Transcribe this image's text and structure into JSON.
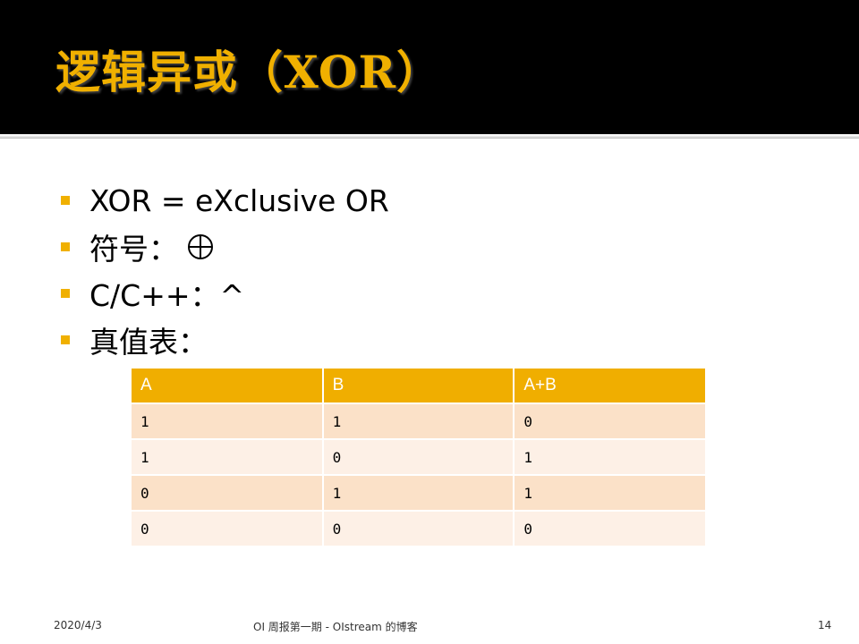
{
  "slide": {
    "title": "逻辑异或（XOR）",
    "bullets": [
      {
        "text": "XOR = eXclusive OR"
      },
      {
        "text": "符号：",
        "icon": "circled-plus-icon"
      },
      {
        "text": "C/C++：^"
      },
      {
        "text": "真值表："
      }
    ],
    "table": {
      "headers": [
        "A",
        "B",
        "A+B"
      ],
      "rows": [
        [
          "1",
          "1",
          "0"
        ],
        [
          "1",
          "0",
          "1"
        ],
        [
          "0",
          "1",
          "1"
        ],
        [
          "0",
          "0",
          "0"
        ]
      ]
    },
    "footer": {
      "date": "2020/4/3",
      "center": "OI 周报第一期 - OIstream 的博客",
      "page": "14"
    }
  },
  "colors": {
    "title_bar": "#000000",
    "accent": "#F0B000",
    "table_header": "#F0AE00",
    "row_odd": "#FBE1C8",
    "row_even": "#FDF0E6"
  }
}
